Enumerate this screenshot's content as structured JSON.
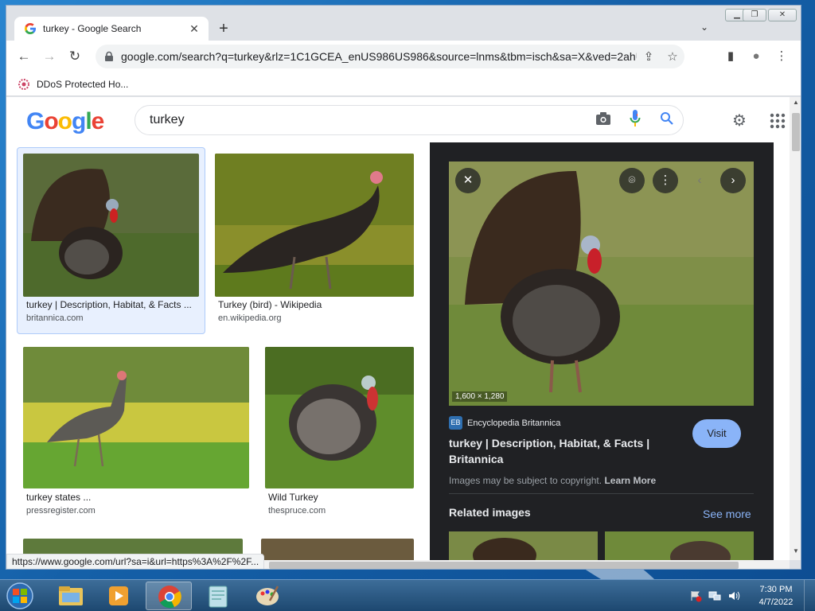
{
  "browser": {
    "tab_title": "turkey - Google Search",
    "tab_close": "✕",
    "new_tab": "+",
    "tab_search": "⌄",
    "window_controls": {
      "minimize": "▁",
      "restore": "❐",
      "close": "✕"
    },
    "nav": {
      "back": "←",
      "forward": "→",
      "reload": "↻"
    },
    "url": "google.com/search?q=turkey&rlz=1C1GCEA_enUS986US986&source=lnms&tbm=isch&sa=X&ved=2ahUK...",
    "toolbar_icons": {
      "share": "⇪",
      "star": "☆",
      "side_panel": "▮",
      "profile": "●",
      "menu": "⋮"
    },
    "bookmark": {
      "label": "DDoS Protected Ho..."
    },
    "status_url": "https://www.google.com/url?sa=i&url=https%3A%2F%2F..."
  },
  "google": {
    "logo": "Google",
    "query": "turkey",
    "settings_icon": "⚙",
    "apps_icon": "⋮⋮⋮"
  },
  "results": [
    {
      "title": "turkey | Description, Habitat, & Facts ...",
      "source": "britannica.com"
    },
    {
      "title": "Turkey (bird) - Wikipedia",
      "source": "en.wikipedia.org"
    },
    {
      "title": "turkey states ...",
      "source": "pressregister.com"
    },
    {
      "title": "Wild Turkey",
      "source": "thespruce.com"
    }
  ],
  "panel": {
    "close": "✕",
    "lens": "⌾",
    "more": "⋮",
    "prev": "‹",
    "next": "›",
    "dimensions": "1,600 × 1,280",
    "source_name": "Encyclopedia Britannica",
    "title": "turkey | Description, Habitat, & Facts | Britannica",
    "visit": "Visit",
    "copyright": "Images may be subject to copyright.",
    "learn_more": "Learn More",
    "related_title": "Related images",
    "see_more": "See more"
  },
  "taskbar": {
    "time": "7:30 PM",
    "date": "4/7/2022"
  },
  "colors": {
    "accent": "#8ab4f8",
    "panel_bg": "#202124",
    "selected_card": "#e8f0fe"
  }
}
